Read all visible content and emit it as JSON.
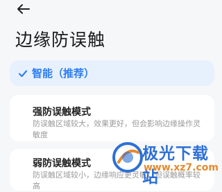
{
  "header": {
    "back_icon": "back-arrow-icon"
  },
  "page": {
    "title": "边缘防误触"
  },
  "options": [
    {
      "label": "智能（推荐）",
      "selected": true
    },
    {
      "label": "强防误触模式",
      "description": "防误触区域较大，效果更好，但会影响边缘操作灵敏度",
      "selected": false
    },
    {
      "label": "弱防误触模式",
      "description": "防误触区域较小，边缘响应更灵敏，但误触概率较高",
      "selected": false
    }
  ],
  "colors": {
    "accent": "#2f7df4",
    "selected_bg": "#e7f1fd",
    "page_bg": "#f6f7f9"
  },
  "watermark": {
    "name": "极光下载站",
    "url": "www.xz7.com"
  }
}
